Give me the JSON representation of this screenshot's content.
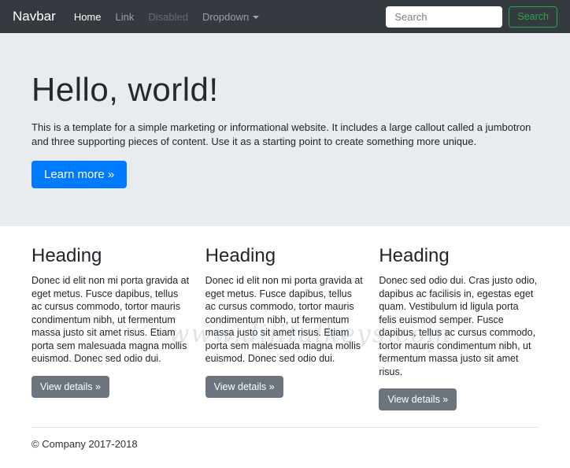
{
  "navbar": {
    "brand": "Navbar",
    "links": [
      {
        "label": "Home",
        "state": "active"
      },
      {
        "label": "Link",
        "state": "normal"
      },
      {
        "label": "Disabled",
        "state": "disabled"
      },
      {
        "label": "Dropdown",
        "state": "dropdown"
      }
    ],
    "search": {
      "placeholder": "Search",
      "button_label": "Search"
    }
  },
  "jumbotron": {
    "title": "Hello, world!",
    "description": "This is a template for a simple marketing or informational website. It includes a large callout called a jumbotron and three supporting pieces of content. Use it as a starting point to create something more unique.",
    "cta_label": "Learn more »"
  },
  "columns": [
    {
      "heading": "Heading",
      "body": "Donec id elit non mi porta gravida at eget metus. Fusce dapibus, tellus ac cursus commodo, tortor mauris condimentum nibh, ut fermentum massa justo sit amet risus. Etiam porta sem malesuada magna mollis euismod. Donec sed odio dui.",
      "button_label": "View details »"
    },
    {
      "heading": "Heading",
      "body": "Donec id elit non mi porta gravida at eget metus. Fusce dapibus, tellus ac cursus commodo, tortor mauris condimentum nibh, ut fermentum massa justo sit amet risus. Etiam porta sem malesuada magna mollis euismod. Donec sed odio dui.",
      "button_label": "View details »"
    },
    {
      "heading": "Heading",
      "body": "Donec sed odio dui. Cras justo odio, dapibus ac facilisis in, egestas eget quam. Vestibulum id ligula porta felis euismod semper. Fusce dapibus, tellus ac cursus commodo, tortor mauris condimentum nibh, ut fermentum massa justo sit amet risus.",
      "button_label": "View details »"
    }
  ],
  "footer": {
    "copyright": "© Company 2017-2018"
  },
  "watermark_text": "www.dijitalkeys.com",
  "colors": {
    "navbar_bg": "#343a40",
    "jumbotron_bg": "#e9ecef",
    "primary": "#007bff",
    "secondary": "#6c757d",
    "success_outline": "#28a745"
  }
}
